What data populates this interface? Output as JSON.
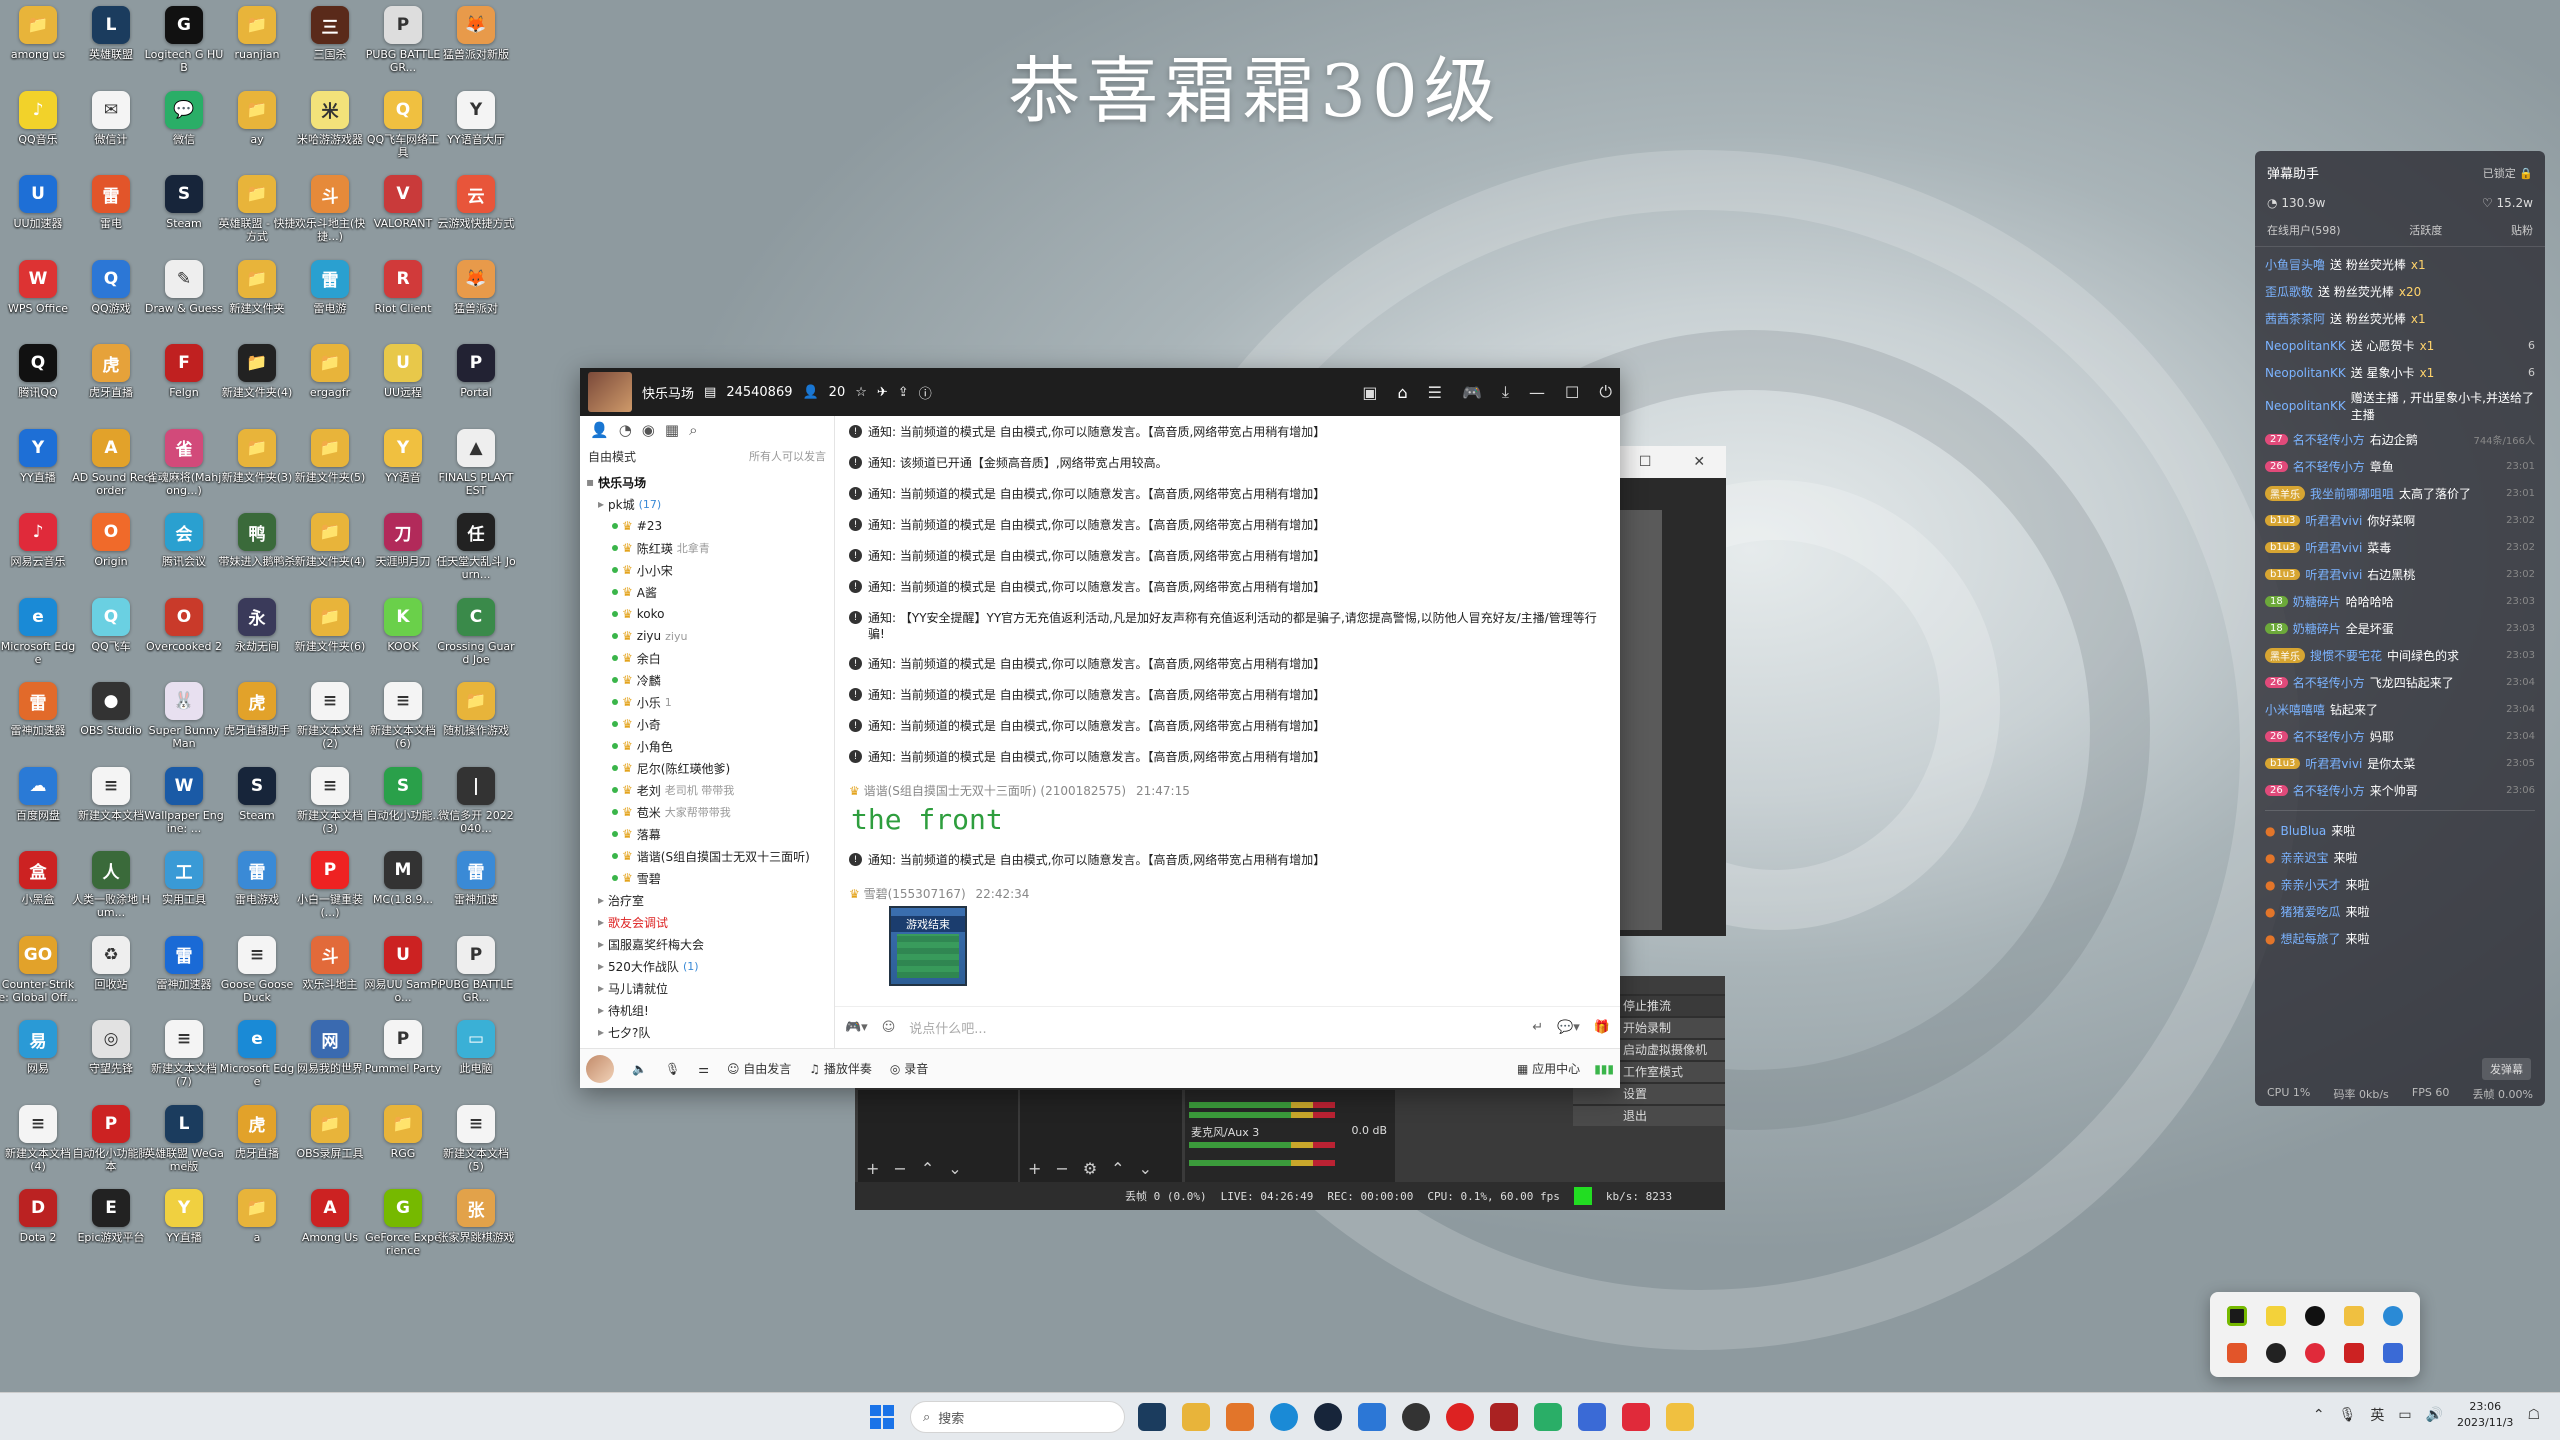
{
  "desktop_title": "恭喜霜霜30级",
  "desktop_icons": [
    {
      "label": "among us",
      "glyph": "📁",
      "color": "#e8b43a"
    },
    {
      "label": "英雄联盟",
      "glyph": "L",
      "color": "#1b3c5e"
    },
    {
      "label": "Logitech G HUB",
      "glyph": "G",
      "color": "#111"
    },
    {
      "label": "ruanjian",
      "glyph": "📁",
      "color": "#e8b43a"
    },
    {
      "label": "三国杀",
      "glyph": "三",
      "color": "#5a2a1a"
    },
    {
      "label": "PUBG BATTLEGR...",
      "glyph": "P",
      "color": "#ddd"
    },
    {
      "label": "猛兽派对新版",
      "glyph": "🦊",
      "color": "#e89a4a"
    },
    {
      "label": "QQ音乐",
      "glyph": "♪",
      "color": "#f2d22a"
    },
    {
      "label": "微信计",
      "glyph": "✉",
      "color": "#f4f4f4"
    },
    {
      "label": "微信",
      "glyph": "💬",
      "color": "#2aae67"
    },
    {
      "label": "ay",
      "glyph": "📁",
      "color": "#e8b43a"
    },
    {
      "label": "米哈游游戏器",
      "glyph": "米",
      "color": "#f3e27a"
    },
    {
      "label": "QQ飞车网络工具",
      "glyph": "Q",
      "color": "#f0c040"
    },
    {
      "label": "YY语音大厅",
      "glyph": "Y",
      "color": "#f4f4f4"
    },
    {
      "label": "UU加速器",
      "glyph": "U",
      "color": "#1e6fd6"
    },
    {
      "label": "雷电",
      "glyph": "雷",
      "color": "#e2552a"
    },
    {
      "label": "Steam",
      "glyph": "S",
      "color": "#17253a"
    },
    {
      "label": "英雄联盟 - 快捷方式",
      "glyph": "📁",
      "color": "#e8b43a"
    },
    {
      "label": "欢乐斗地主(快捷...)",
      "glyph": "斗",
      "color": "#e68a3a"
    },
    {
      "label": "VALORANT",
      "glyph": "V",
      "color": "#c93a3a"
    },
    {
      "label": "云游戏快捷方式",
      "glyph": "云",
      "color": "#e8553a"
    },
    {
      "label": "WPS Office",
      "glyph": "W",
      "color": "#d33"
    },
    {
      "label": "QQ游戏",
      "glyph": "Q",
      "color": "#2c77d6"
    },
    {
      "label": "Draw & Guess",
      "glyph": "✎",
      "color": "#eee"
    },
    {
      "label": "新建文件夹",
      "glyph": "📁",
      "color": "#e8b43a"
    },
    {
      "label": "雷电游",
      "glyph": "雷",
      "color": "#2aa0d0"
    },
    {
      "label": "Riot Client",
      "glyph": "R",
      "color": "#d13a3a"
    },
    {
      "label": "猛兽派对",
      "glyph": "🦊",
      "color": "#e89a4a"
    },
    {
      "label": "腾讯QQ",
      "glyph": "Q",
      "color": "#111"
    },
    {
      "label": "虎牙直播",
      "glyph": "虎",
      "color": "#e6a23a"
    },
    {
      "label": "Felgn",
      "glyph": "F",
      "color": "#c02020"
    },
    {
      "label": "新建文件夹(4)",
      "glyph": "📁",
      "color": "#222"
    },
    {
      "label": "ergagfr",
      "glyph": "📁",
      "color": "#e8b43a"
    },
    {
      "label": "UU远程",
      "glyph": "U",
      "color": "#e8c84a"
    },
    {
      "label": "Portal",
      "glyph": "P",
      "color": "#223"
    },
    {
      "label": "YY直播",
      "glyph": "Y",
      "color": "#1e6fd6"
    },
    {
      "label": "AD Sound Recorder",
      "glyph": "A",
      "color": "#e2a22a"
    },
    {
      "label": "雀魂麻将(Mahjong...)",
      "glyph": "雀",
      "color": "#d24a7a"
    },
    {
      "label": "新建文件夹(3)",
      "glyph": "📁",
      "color": "#e8b43a"
    },
    {
      "label": "新建文件夹(5)",
      "glyph": "📁",
      "color": "#e8b43a"
    },
    {
      "label": "YY语音",
      "glyph": "Y",
      "color": "#f0c040"
    },
    {
      "label": "FINALS PLAYTEST",
      "glyph": "▲",
      "color": "#eee"
    },
    {
      "label": "网易云音乐",
      "glyph": "♪",
      "color": "#e02a3a"
    },
    {
      "label": "Origin",
      "glyph": "O",
      "color": "#f06a2a"
    },
    {
      "label": "腾讯会议",
      "glyph": "会",
      "color": "#2aa0d0"
    },
    {
      "label": "带妹进入鹅鸭杀",
      "glyph": "鸭",
      "color": "#3a6a3a"
    },
    {
      "label": "新建文件夹(4)",
      "glyph": "📁",
      "color": "#e8b43a"
    },
    {
      "label": "天涯明月刀",
      "glyph": "刀",
      "color": "#b22a5a"
    },
    {
      "label": "任天堂大乱斗 Journ...",
      "glyph": "任",
      "color": "#222"
    },
    {
      "label": "Microsoft Edge",
      "glyph": "e",
      "color": "#1a8ad6"
    },
    {
      "label": "QQ飞车",
      "glyph": "Q",
      "color": "#6ad0e2"
    },
    {
      "label": "Overcooked 2",
      "glyph": "O",
      "color": "#c93a2a"
    },
    {
      "label": "永劫无间",
      "glyph": "永",
      "color": "#3a3a5a"
    },
    {
      "label": "新建文件夹(6)",
      "glyph": "📁",
      "color": "#e8b43a"
    },
    {
      "label": "KOOK",
      "glyph": "K",
      "color": "#6ad04a"
    },
    {
      "label": "Crossing Guard Joe",
      "glyph": "C",
      "color": "#3a8a4a"
    },
    {
      "label": "雷神加速器",
      "glyph": "雷",
      "color": "#e26a2a"
    },
    {
      "label": "OBS Studio",
      "glyph": "●",
      "color": "#333"
    },
    {
      "label": "Super Bunny Man",
      "glyph": "🐰",
      "color": "#e8e0f0"
    },
    {
      "label": "虎牙直播助手",
      "glyph": "虎",
      "color": "#e2a22a"
    },
    {
      "label": "新建文本文档(2)",
      "glyph": "≡",
      "color": "#f4f4f4"
    },
    {
      "label": "新建文本文档(6)",
      "glyph": "≡",
      "color": "#f4f4f4"
    },
    {
      "label": "随机操作游戏",
      "glyph": "📁",
      "color": "#e8b43a"
    },
    {
      "label": "百度网盘",
      "glyph": "☁",
      "color": "#2a7ad6"
    },
    {
      "label": "新建文本文档",
      "glyph": "≡",
      "color": "#f4f4f4"
    },
    {
      "label": "Wallpaper Engine: ...",
      "glyph": "W",
      "color": "#1a5aa6"
    },
    {
      "label": "Steam",
      "glyph": "S",
      "color": "#17253a"
    },
    {
      "label": "新建文本文档(3)",
      "glyph": "≡",
      "color": "#f4f4f4"
    },
    {
      "label": "自动化小功能..",
      "glyph": "S",
      "color": "#2aa04a"
    },
    {
      "label": "微信多开 2022040...",
      "glyph": "|",
      "color": "#333"
    },
    {
      "label": "小黑盒",
      "glyph": "盒",
      "color": "#c22"
    },
    {
      "label": "人类一败涂地 Hum...",
      "glyph": "人",
      "color": "#3a6a3a"
    },
    {
      "label": "实用工具",
      "glyph": "工",
      "color": "#3a9ad6"
    },
    {
      "label": "雷电游戏",
      "glyph": "雷",
      "color": "#3a8ad6"
    },
    {
      "label": "小白一键重装(...)",
      "glyph": "P",
      "color": "#e22"
    },
    {
      "label": "MC(1.8.9...",
      "glyph": "M",
      "color": "#333"
    },
    {
      "label": "雷神加速",
      "glyph": "雷",
      "color": "#3a8ad6"
    },
    {
      "label": "Counter-Strike: Global Off...",
      "glyph": "GO",
      "color": "#e2a22a"
    },
    {
      "label": "回收站",
      "glyph": "♻",
      "color": "#eee"
    },
    {
      "label": "雷神加速器",
      "glyph": "雷",
      "color": "#1a6ad6"
    },
    {
      "label": "Goose Goose Duck",
      "glyph": "≡",
      "color": "#f4f4f4"
    },
    {
      "label": "欢乐斗地主",
      "glyph": "斗",
      "color": "#e26a3a"
    },
    {
      "label": "网易UU SamPro...",
      "glyph": "U",
      "color": "#c22"
    },
    {
      "label": "PUBG BATTLEGR...",
      "glyph": "P",
      "color": "#eee"
    },
    {
      "label": "网易",
      "glyph": "易",
      "color": "#2a9ad6"
    },
    {
      "label": "守望先锋",
      "glyph": "◎",
      "color": "#e2e2e2"
    },
    {
      "label": "新建文本文档(7)",
      "glyph": "≡",
      "color": "#f4f4f4"
    },
    {
      "label": "Microsoft Edge",
      "glyph": "e",
      "color": "#1a8ad6"
    },
    {
      "label": "网易我的世界",
      "glyph": "网",
      "color": "#3a6ab0"
    },
    {
      "label": "Pummel Party",
      "glyph": "P",
      "color": "#f4f4f4"
    },
    {
      "label": "此电脑",
      "glyph": "▭",
      "color": "#3ab0d6"
    },
    {
      "label": "新建文本文档(4)",
      "glyph": "≡",
      "color": "#f4f4f4"
    },
    {
      "label": "自动化小功能脚本",
      "glyph": "P",
      "color": "#c22"
    },
    {
      "label": "英雄联盟 WeGame版",
      "glyph": "L",
      "color": "#1b3c5e"
    },
    {
      "label": "虎牙直播",
      "glyph": "虎",
      "color": "#e2a22a"
    },
    {
      "label": "OBS录屏工具",
      "glyph": "📁",
      "color": "#e8b43a"
    },
    {
      "label": "RGG",
      "glyph": "📁",
      "color": "#e8b43a"
    },
    {
      "label": "新建文本文档(5)",
      "glyph": "≡",
      "color": "#f4f4f4"
    },
    {
      "label": "Dota 2",
      "glyph": "D",
      "color": "#b22"
    },
    {
      "label": "Epic游戏平台",
      "glyph": "E",
      "color": "#222"
    },
    {
      "label": "YY直播",
      "glyph": "Y",
      "color": "#f0d040"
    },
    {
      "label": "a",
      "glyph": "📁",
      "color": "#e8b43a"
    },
    {
      "label": "Among Us",
      "glyph": "A",
      "color": "#c22"
    },
    {
      "label": "GeForce Experience",
      "glyph": "G",
      "color": "#76b900"
    },
    {
      "label": "张家界跳棋游戏",
      "glyph": "张",
      "color": "#e2a24a"
    }
  ],
  "yy": {
    "channel_name": "快乐马场",
    "channel_id": "24540869",
    "user_count": "20",
    "mode_label": "自由模式",
    "mode_sub": "所有人可以发言",
    "tree": [
      {
        "type": "channel",
        "text": "快乐马场"
      },
      {
        "type": "sub",
        "text": "pk城",
        "extra": "(17)"
      },
      {
        "type": "user",
        "text": "#23",
        "crown": "👑"
      },
      {
        "type": "user",
        "text": "陈红瑛",
        "crown": "👑",
        "badge": "北拿青"
      },
      {
        "type": "user",
        "text": "小小宋",
        "crown": "👑"
      },
      {
        "type": "user",
        "text": "A酱",
        "crown": "👑"
      },
      {
        "type": "user",
        "text": "koko",
        "crown": "👑"
      },
      {
        "type": "user",
        "text": "ziyu",
        "crown": "👑",
        "badge": "ziyu"
      },
      {
        "type": "user",
        "text": "余白",
        "crown": "👑"
      },
      {
        "type": "user",
        "text": "冷麟",
        "crown": "👑"
      },
      {
        "type": "user",
        "text": "小乐",
        "crown": "👑",
        "badge": "1"
      },
      {
        "type": "user",
        "text": "小奇",
        "crown": "👑"
      },
      {
        "type": "user",
        "text": "小角色",
        "crown": "👑"
      },
      {
        "type": "user",
        "text": "尼尔(陈红瑛他爹)",
        "crown": "👑"
      },
      {
        "type": "user",
        "text": "老刘",
        "crown": "👑",
        "badge": "老司机 带带我"
      },
      {
        "type": "user",
        "text": "苞米",
        "crown": "👑",
        "badge": "大家帮带带我"
      },
      {
        "type": "user",
        "text": "落幕",
        "crown": "👑"
      },
      {
        "type": "user",
        "text": "谐谐(S组自摸国士无双十三面听)",
        "crown": "👑"
      },
      {
        "type": "user",
        "text": "雪碧",
        "crown": "👑"
      },
      {
        "type": "sub",
        "text": "治疗室"
      },
      {
        "type": "sub-red",
        "text": "歌友会调试"
      },
      {
        "type": "sub",
        "text": "国服嘉奖纤梅大会"
      },
      {
        "type": "sub",
        "text": "520大作战队",
        "extra": "(1)"
      },
      {
        "type": "sub",
        "text": "马儿请就位"
      },
      {
        "type": "sub",
        "text": "待机组!"
      },
      {
        "type": "sub",
        "text": "七夕?队"
      }
    ],
    "notice_text": "通知: 当前频道的模式是 自由模式,你可以随意发言。【高音质,网络带宽占用稍有增加】",
    "notice_quality": "通知: 该频道已开通【金频高音质】,网络带宽占用较高。",
    "notice_security": "通知: 【YY安全提醒】YY官方无充值返利活动,凡是加好友声称有充值返利活动的都是骗子,请您提高警惕,以防他人冒充好友/主播/管理等行骗!",
    "msg_user_1": "谐谐(S组自摸国士无双十三面听) (2100182575)",
    "msg_time_1": "21:47:15",
    "msg_big": "the front",
    "msg_user_2": "雪碧(155307167)",
    "msg_time_2": "22:42:34",
    "img_caption": "游戏结束",
    "input_placeholder": "说点什么吧...",
    "bottom": {
      "free_speak": "自由发言",
      "play_song": "播放伴奏",
      "record": "录音",
      "app_center": "应用中心"
    }
  },
  "obs": {
    "controls_title": "控件",
    "buttons": [
      "停止推流",
      "开始录制",
      "启动虚拟摄像机",
      "工作室模式",
      "设置",
      "退出"
    ],
    "audio_label": "麦克风/Aux 3",
    "audio_db": "0.0 dB",
    "status_dropped": "丢帧 0 (0.0%)",
    "status_live": "LIVE: 04:26:49",
    "status_rec": "REC: 00:00:00",
    "status_cpu": "CPU: 0.1%, 60.00 fps",
    "status_kbs": "kb/s: 8233"
  },
  "danmaku": {
    "title": "弹幕助手",
    "lock_label": "已锁定",
    "viewers": "130.9w",
    "likes": "15.2w",
    "tab_online": "在线用户(598)",
    "tab_active": "活跃度",
    "tab_gift": "贴粉",
    "rows": [
      {
        "name": "小鱼冒头噜",
        "text": "送 粉丝荧光棒",
        "gift": "x1"
      },
      {
        "name": "歪瓜歌敬",
        "text": "送 粉丝荧光棒",
        "gift": "x20"
      },
      {
        "name": "茜茜茶茶阿",
        "text": "送 粉丝荧光棒",
        "gift": "x1"
      },
      {
        "name": "NeopolitanKK",
        "text": "送 心愿贺卡",
        "gift": "x1",
        "cnt": "6"
      },
      {
        "name": "NeopolitanKK",
        "text": "送 星象小卡",
        "gift": "x1",
        "cnt": "6"
      },
      {
        "name": "NeopolitanKK",
        "text": "赠送主播 , 开出星象小卡,并送给了主播",
        "gift": ""
      },
      {
        "lv": "27",
        "name": "名不轻传小方",
        "text": "右边企鹅",
        "time": "744条/166人"
      },
      {
        "lv": "26",
        "name": "名不轻传小方",
        "text": "章鱼",
        "time": "23:01"
      },
      {
        "lv": "黑羊乐",
        "name": "我坐前哪哪咀咀",
        "text": "太高了落价了",
        "time": "23:01"
      },
      {
        "lv": "b1u3",
        "name": "听君君vivi",
        "text": "你好菜啊",
        "time": "23:02"
      },
      {
        "lv": "b1u3",
        "name": "听君君vivi",
        "text": "菜毒",
        "time": "23:02"
      },
      {
        "lv": "b1u3",
        "name": "听君君vivi",
        "text": "右边黑桃",
        "time": "23:02"
      },
      {
        "lv": "18",
        "name": "奶糖碎片",
        "text": "哈哈哈哈",
        "time": "23:03"
      },
      {
        "lv": "18",
        "name": "奶糖碎片",
        "text": "全是坏蛋",
        "time": "23:03"
      },
      {
        "lv": "黑羊乐",
        "name": "搜惯不要宅花",
        "text": "中间绿色的求",
        "time": "23:03"
      },
      {
        "lv": "26",
        "name": "名不轻传小方",
        "text": "飞龙四钻起来了",
        "time": "23:04"
      },
      {
        "lv": "",
        "name": "小米嘻嘻嘻",
        "text": "钻起来了",
        "time": "23:04"
      },
      {
        "lv": "26",
        "name": "名不轻传小方",
        "text": "妈耶",
        "time": "23:04"
      },
      {
        "lv": "b1u3",
        "name": "听君君vivi",
        "text": "是你太菜",
        "time": "23:05"
      },
      {
        "lv": "26",
        "name": "名不轻传小方",
        "text": "来个帅哥",
        "time": "23:06"
      }
    ],
    "enter_rows": [
      {
        "name": "BluBlua",
        "text": "来啦"
      },
      {
        "name": "亲亲迟宝",
        "text": "来啦"
      },
      {
        "name": "亲亲小天才",
        "text": "来啦"
      },
      {
        "name": "猪猪爱吃瓜",
        "text": "来啦"
      },
      {
        "name": "想起每旅了",
        "text": "来啦"
      }
    ],
    "send_btn": "发弹幕",
    "foot_cpu": "CPU 1%",
    "foot_rate": "码率 0kb/s",
    "foot_fps": "FPS 60",
    "foot_drop": "丢帧 0.00%"
  },
  "taskbar": {
    "search_placeholder": "搜索",
    "ime": "英",
    "time": "23:06",
    "date": "2023/11/3"
  }
}
